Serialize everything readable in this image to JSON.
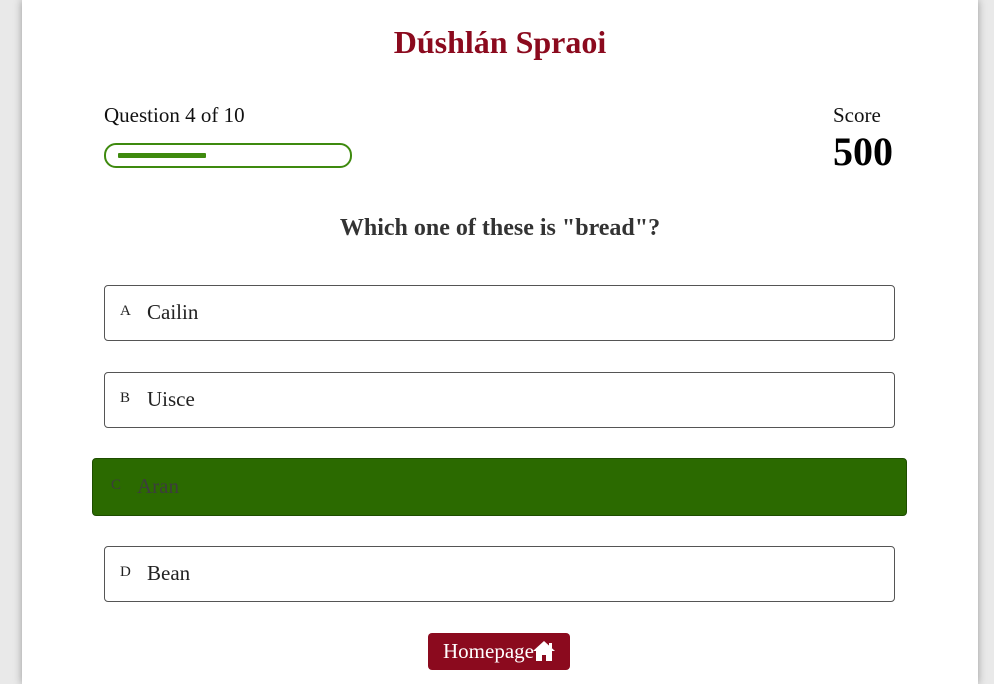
{
  "app": {
    "title": "Dúshlán Spraoi"
  },
  "progress": {
    "label": "Question 4 of 10",
    "fraction": 0.4
  },
  "score": {
    "label": "Score",
    "value": "500"
  },
  "question": {
    "text": "Which one of these is \"bread\"?"
  },
  "options": [
    {
      "letter": "A",
      "text": "Cailin"
    },
    {
      "letter": "B",
      "text": "Uisce"
    },
    {
      "letter": "C",
      "text": "Aran",
      "selected": true
    },
    {
      "letter": "D",
      "text": "Bean"
    }
  ],
  "home_button": {
    "label": "Homepage",
    "icon": "home-icon"
  },
  "colors": {
    "brand": "#8b0a1e",
    "progress": "#3e8a0e",
    "selected": "#2b6a00"
  }
}
